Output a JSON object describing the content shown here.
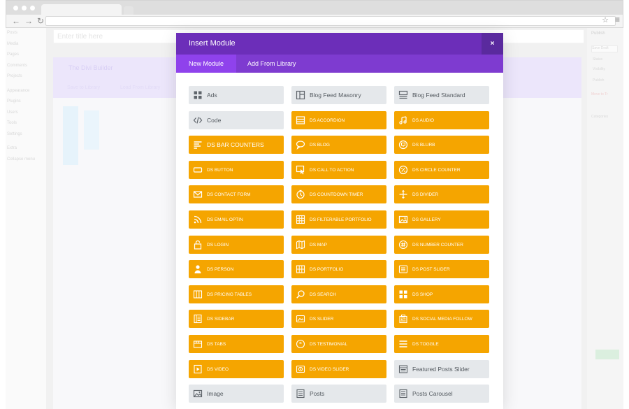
{
  "background": {
    "title_placeholder": "Enter title here",
    "builder_title": "The Divi Builder",
    "save_to_library": "Save to Library",
    "load_from_library": "Load From Library",
    "sidebar_items": [
      "Posts",
      "Media",
      "Pages",
      "Comments",
      "Projects",
      "Appearance",
      "Plugins",
      "Users",
      "Tools",
      "Settings",
      "Extra",
      "Collapse menu"
    ],
    "publish_label": "Publish",
    "save_draft": "Save Draft",
    "status_label": "Status",
    "visibility_label": "Visibility",
    "publish_meta": "Publish",
    "move_to_trash": "Move to Tr",
    "categories_label": "Categories"
  },
  "modal": {
    "title": "Insert Module",
    "close_glyph": "×",
    "tabs": [
      {
        "label": "New Module"
      },
      {
        "label": "Add From Library"
      }
    ],
    "modules": [
      {
        "label": "Ads",
        "style": "grey",
        "icon": "grid-icon"
      },
      {
        "label": "Blog Feed Masonry",
        "style": "grey",
        "icon": "masonry-icon"
      },
      {
        "label": "Blog Feed Standard",
        "style": "grey",
        "icon": "blog-standard-icon"
      },
      {
        "label": "Code",
        "style": "grey",
        "icon": "code-icon"
      },
      {
        "label": "DS ACCORDION",
        "style": "orange",
        "icon": "accordion-icon"
      },
      {
        "label": "DS AUDIO",
        "style": "orange",
        "icon": "music-icon"
      },
      {
        "label": "DS BAR COUNTERS",
        "style": "orange big",
        "icon": "bars-icon"
      },
      {
        "label": "DS BLOG",
        "style": "orange",
        "icon": "chat-icon"
      },
      {
        "label": "DS BLURB",
        "style": "orange",
        "icon": "blurb-icon"
      },
      {
        "label": "DS BUTTON",
        "style": "orange",
        "icon": "button-icon"
      },
      {
        "label": "DS CALL TO ACTION",
        "style": "orange",
        "icon": "cursor-icon"
      },
      {
        "label": "DS CIRCLE COUNTER",
        "style": "orange",
        "icon": "percent-icon"
      },
      {
        "label": "DS CONTACT FORM",
        "style": "orange",
        "icon": "envelope-icon"
      },
      {
        "label": "DS COUNTDOWN TIMER",
        "style": "orange",
        "icon": "timer-icon"
      },
      {
        "label": "DS DIVIDER",
        "style": "orange",
        "icon": "divider-icon"
      },
      {
        "label": "DS EMAIL OPTIN",
        "style": "orange",
        "icon": "rss-icon"
      },
      {
        "label": "DS FILTERABLE PORTFOLIO",
        "style": "orange",
        "icon": "portfolio-grid-icon"
      },
      {
        "label": "DS GALLERY",
        "style": "orange",
        "icon": "image-icon"
      },
      {
        "label": "DS LOGIN",
        "style": "orange",
        "icon": "lock-icon"
      },
      {
        "label": "DS MAP",
        "style": "orange",
        "icon": "map-icon"
      },
      {
        "label": "DS NUMBER COUNTER",
        "style": "orange",
        "icon": "hash-icon"
      },
      {
        "label": "DS PERSON",
        "style": "orange",
        "icon": "person-icon"
      },
      {
        "label": "DS PORTFOLIO",
        "style": "orange",
        "icon": "portfolio-icon"
      },
      {
        "label": "DS POST SLIDER",
        "style": "orange",
        "icon": "post-slider-icon"
      },
      {
        "label": "DS PRICING TABLES",
        "style": "orange",
        "icon": "pricing-icon"
      },
      {
        "label": "DS SEARCH",
        "style": "orange",
        "icon": "search-icon"
      },
      {
        "label": "DS SHOP",
        "style": "orange",
        "icon": "shop-icon"
      },
      {
        "label": "DS SIDEBAR",
        "style": "orange",
        "icon": "sidebar-icon"
      },
      {
        "label": "DS SLIDER",
        "style": "orange",
        "icon": "slider-icon"
      },
      {
        "label": "DS SOCIAL MEDIA FOLLOW",
        "style": "orange",
        "icon": "social-icon"
      },
      {
        "label": "DS TABS",
        "style": "orange",
        "icon": "tabs-icon"
      },
      {
        "label": "DS TESTIMONIAL",
        "style": "orange",
        "icon": "quote-icon"
      },
      {
        "label": "DS TOGGLE",
        "style": "orange",
        "icon": "toggle-icon"
      },
      {
        "label": "DS VIDEO",
        "style": "orange",
        "icon": "video-icon"
      },
      {
        "label": "DS VIDEO SLIDER",
        "style": "orange",
        "icon": "video-slider-icon"
      },
      {
        "label": "Featured Posts Slider",
        "style": "grey",
        "icon": "featured-slider-icon"
      },
      {
        "label": "Image",
        "style": "grey",
        "icon": "image-icon"
      },
      {
        "label": "Posts",
        "style": "grey",
        "icon": "posts-icon"
      },
      {
        "label": "Posts Carousel",
        "style": "grey",
        "icon": "carousel-icon"
      }
    ]
  },
  "colors": {
    "header_purple": "#6c2eb9",
    "tab_purple": "#7e3bd0",
    "active_tab_purple": "#8f42ec",
    "module_orange": "#f5a500",
    "module_grey": "#e5e8eb"
  }
}
